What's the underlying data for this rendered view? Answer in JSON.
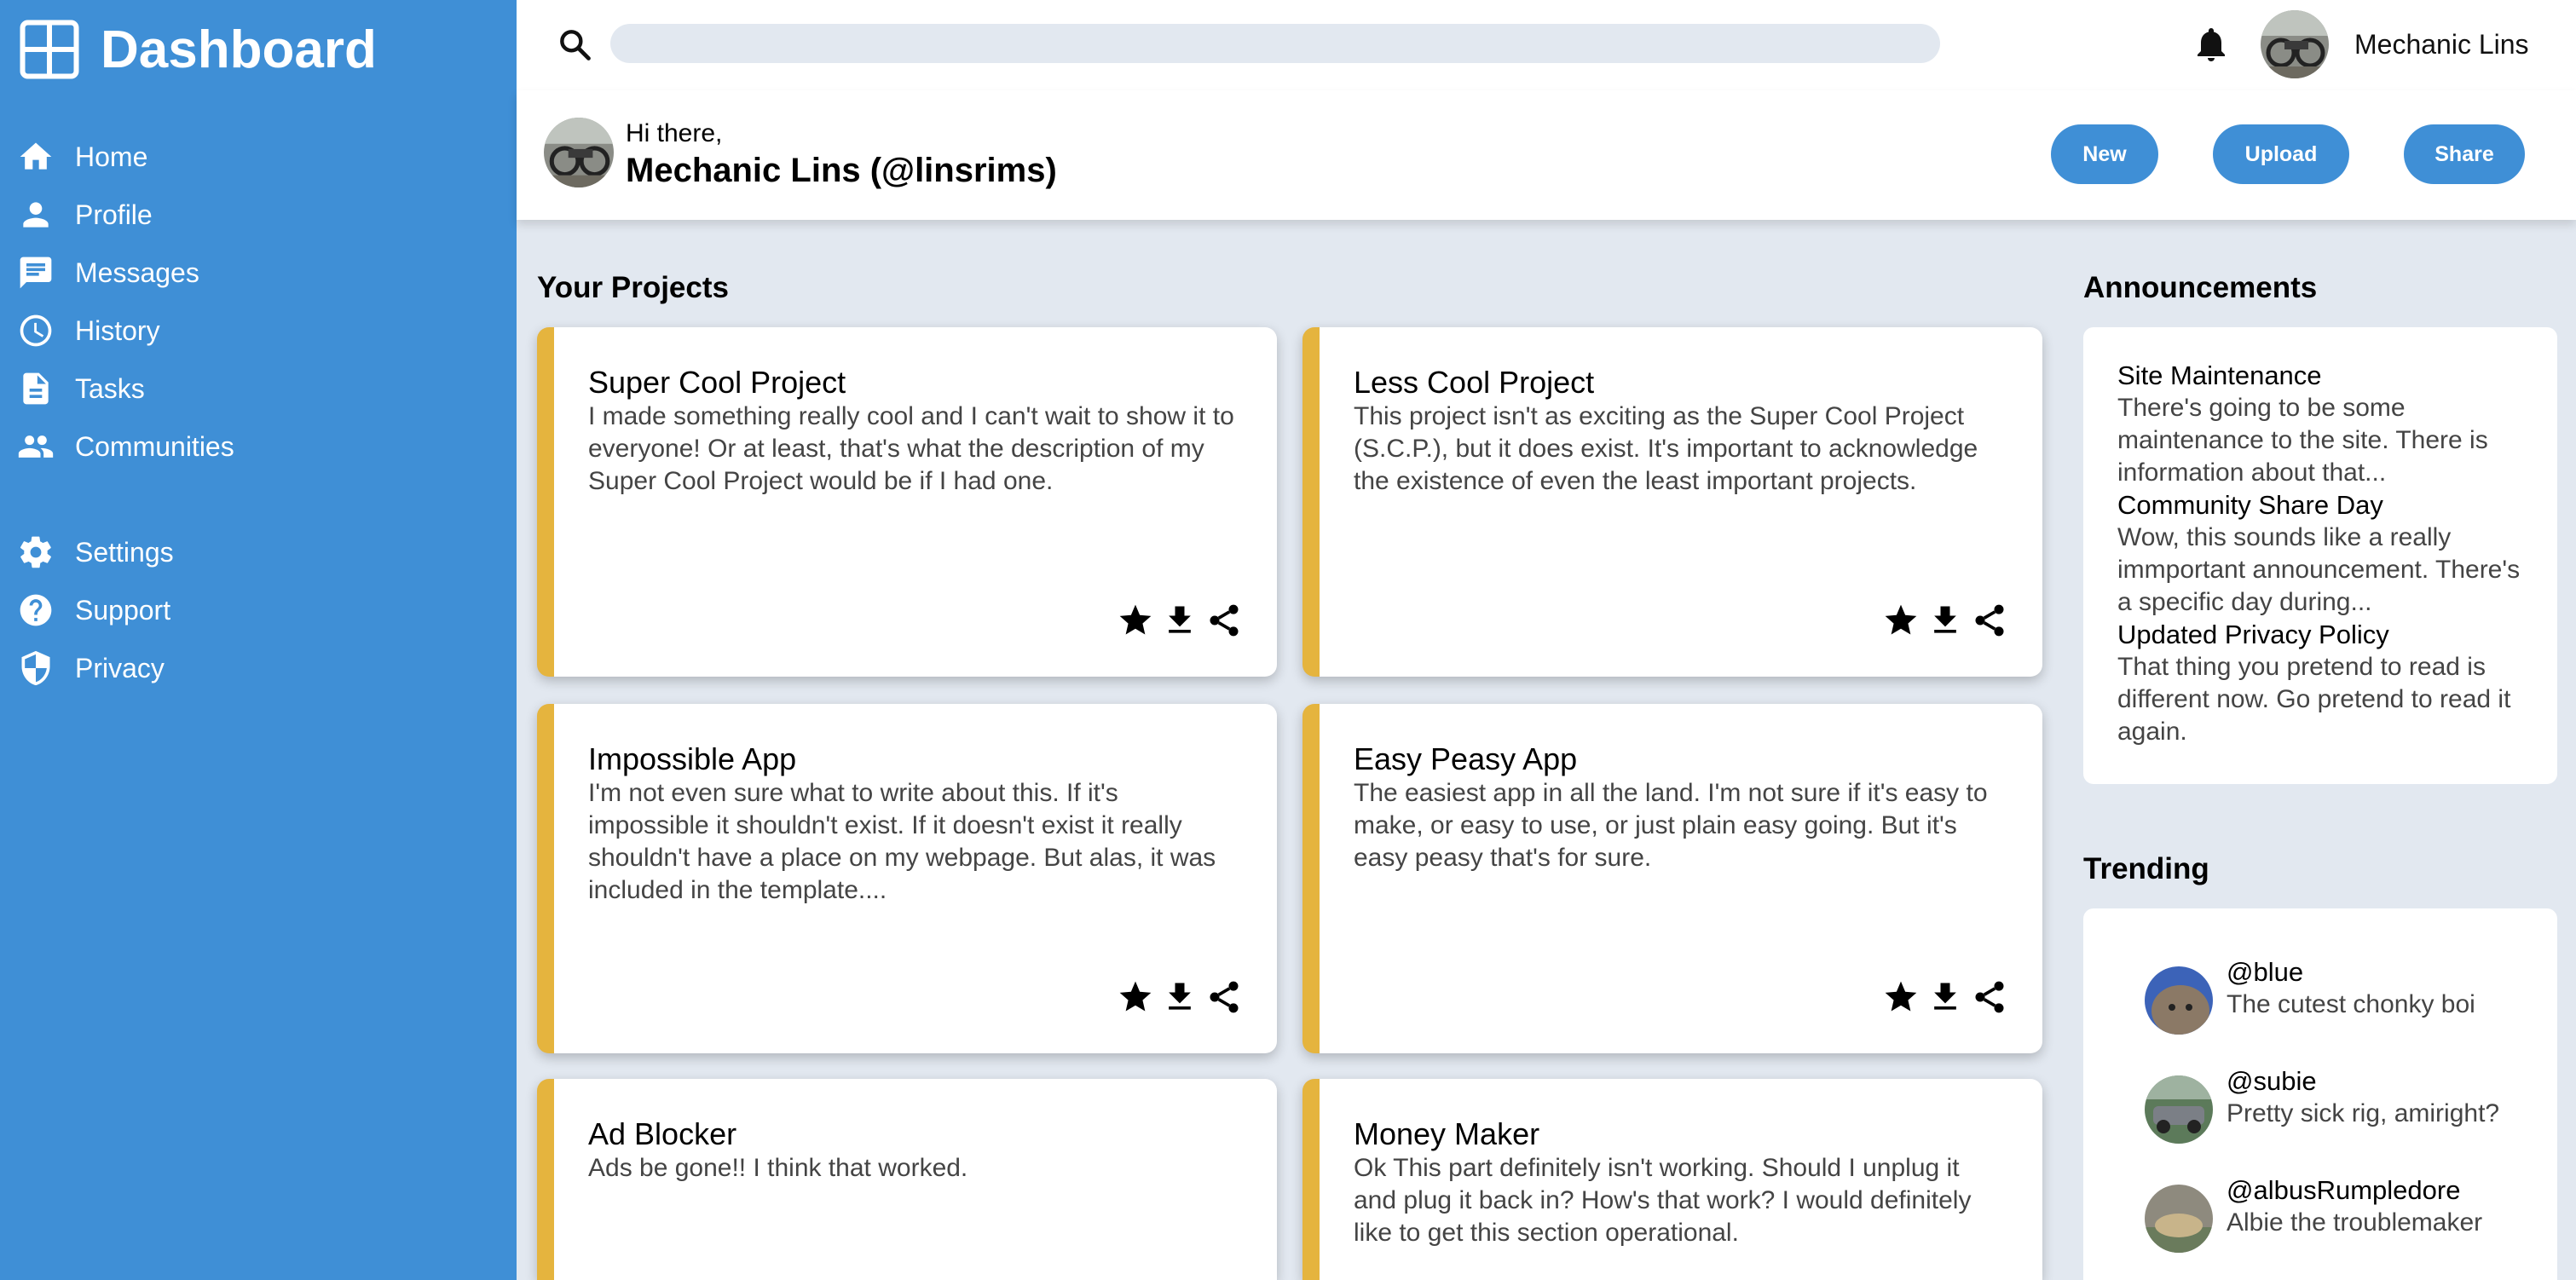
{
  "sidebar": {
    "title": "Dashboard",
    "items": [
      {
        "label": "Home",
        "icon": "home-icon"
      },
      {
        "label": "Profile",
        "icon": "person-icon"
      },
      {
        "label": "Messages",
        "icon": "chat-icon"
      },
      {
        "label": "History",
        "icon": "clock-icon"
      },
      {
        "label": "Tasks",
        "icon": "document-icon"
      },
      {
        "label": "Communities",
        "icon": "group-icon"
      }
    ],
    "secondary_items": [
      {
        "label": "Settings",
        "icon": "gear-icon"
      },
      {
        "label": "Support",
        "icon": "help-icon"
      },
      {
        "label": "Privacy",
        "icon": "shield-icon"
      }
    ],
    "background_color": "#3f8fd6"
  },
  "topbar": {
    "search_placeholder": "",
    "username": "Mechanic Lins"
  },
  "greeting": {
    "hi": "Hi there,",
    "name": "Mechanic Lins (@linsrims)"
  },
  "actions": {
    "new_label": "New",
    "upload_label": "Upload",
    "share_label": "Share"
  },
  "projects": {
    "title": "Your Projects",
    "accent_color": "#e5b43e",
    "items": [
      {
        "title": "Super Cool Project",
        "description": "I made something really cool and I can't wait to show it to everyone! Or at least, that's what the description of my Super Cool Project would be if I had one."
      },
      {
        "title": "Less Cool Project",
        "description": "This project isn't as exciting as the Super Cool Project (S.C.P.), but it does exist. It's important to acknowledge the existence of even the least important projects."
      },
      {
        "title": "Impossible App",
        "description": "I'm not even sure what to write about this. If it's impossible it shouldn't exist. If it doesn't exist it really shouldn't have a place on my webpage. But alas, it was included in the template...."
      },
      {
        "title": "Easy Peasy App",
        "description": "The easiest app in all the land. I'm not sure if it's easy to make, or easy to use, or just plain easy going. But it's easy peasy that's for sure."
      },
      {
        "title": "Ad Blocker",
        "description": "Ads be gone!! I think that worked."
      },
      {
        "title": "Money Maker",
        "description": "Ok This part definitely isn't working. Should I unplug it and plug it back in? How's that work? I would definitely like to get this section operational."
      }
    ]
  },
  "announcements": {
    "title": "Announcements",
    "items": [
      {
        "title": "Site Maintenance",
        "body": "There's going to be some maintenance to the site. There is information about that..."
      },
      {
        "title": "Community Share Day",
        "body": "Wow, this sounds like a really immportant announcement. There's a specific day during..."
      },
      {
        "title": "Updated Privacy Policy",
        "body": "That thing you pretend to read is different now. Go pretend to read it again."
      }
    ]
  },
  "trending": {
    "title": "Trending",
    "items": [
      {
        "handle": "@blue",
        "text": "The cutest chonky boi"
      },
      {
        "handle": "@subie",
        "text": "Pretty sick rig, amiright?"
      },
      {
        "handle": "@albusRumpledore",
        "text": "Albie the troublemaker"
      }
    ]
  }
}
